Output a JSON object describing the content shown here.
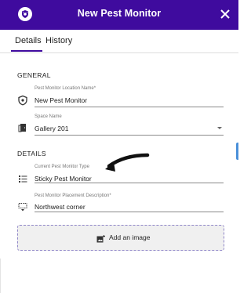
{
  "header": {
    "title": "New Pest Monitor",
    "logo_icon": "bug-shield-icon",
    "close_icon": "close-icon",
    "background": "#3f0b9e"
  },
  "tabs": [
    {
      "label": "Details",
      "active": true
    },
    {
      "label": "History",
      "active": false
    }
  ],
  "sections": {
    "general": "GENERAL",
    "details": "DETAILS"
  },
  "fields": {
    "location_name": {
      "label": "Pest Monitor Location Name",
      "required": "*",
      "value": "New Pest Monitor",
      "icon": "badge-shield-icon"
    },
    "space_name": {
      "label": "Space Name",
      "value": "Gallery 201",
      "icon": "door-icon"
    },
    "monitor_type": {
      "label": "Current Pest Monitor Type",
      "value": "Sticky Pest Monitor",
      "icon": "list-icon"
    },
    "placement": {
      "label": "Pest Monitor Placement Description",
      "required": "*",
      "value": "Northwest corner",
      "icon": "placement-icon"
    }
  },
  "add_image": {
    "label": "Add an image",
    "icon": "add-image-icon"
  },
  "accent_color": "#3f0b9e"
}
